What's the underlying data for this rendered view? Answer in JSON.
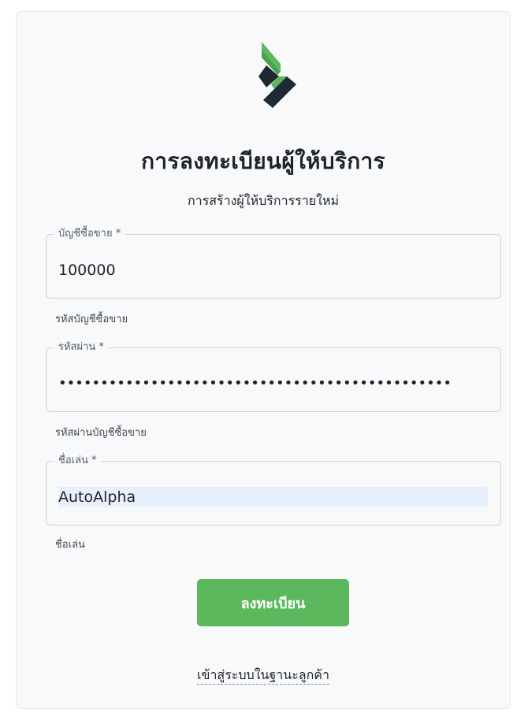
{
  "logo": {
    "icon": "chevron-logo-icon",
    "colors": {
      "green": "#5cb85c",
      "dark": "#1e2a33"
    }
  },
  "header": {
    "title": "การลงทะเบียนผู้ให้บริการ",
    "subtitle": "การสร้างผู้ให้บริการรายใหม่"
  },
  "form": {
    "account": {
      "label": "บัญชีซื้อขาย *",
      "value": "100000",
      "helper": "รหัสบัญชีซื้อขาย"
    },
    "password": {
      "label": "รหัสผ่าน *",
      "value": "•••••••••••••••••••••••••••••••••••••••••••••••",
      "helper": "รหัสผ่านบัญชีซื้อขาย"
    },
    "nickname": {
      "label": "ชื่อเล่น *",
      "value": "AutoAlpha",
      "helper": "ชื่อเล่น"
    },
    "submit_label": "ลงทะเบียน"
  },
  "footer": {
    "login_link": "เข้าสู่ระบบในฐานะลูกค้า"
  },
  "colors": {
    "accent": "#5cb85c",
    "card_background": "#f8f9fa",
    "autofill_background": "#e8f0fe"
  }
}
